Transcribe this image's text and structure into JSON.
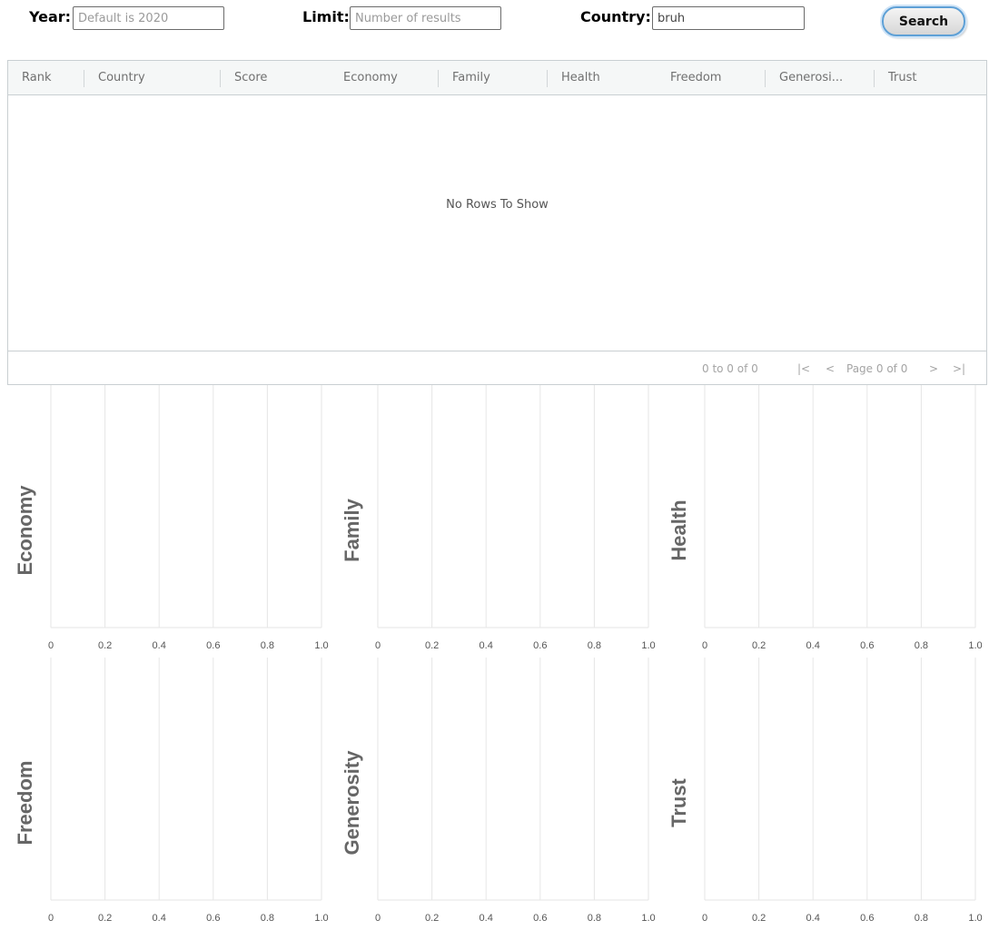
{
  "search": {
    "year_label": "Year:",
    "year_placeholder": "Default is 2020",
    "limit_label": "Limit:",
    "limit_placeholder": "Number of results",
    "country_label": "Country:",
    "country_value": "bruh",
    "search_button": "Search"
  },
  "grid": {
    "columns": [
      "Rank",
      "Country",
      "Score",
      "Economy",
      "Family",
      "Health",
      "Freedom",
      "Generosi...",
      "Trust"
    ],
    "no_rows_text": "No Rows To Show",
    "pagination": {
      "summary": "0 to 0 of 0",
      "first": "|<",
      "prev": "<",
      "page_text": "Page 0 of 0",
      "next": ">",
      "last": ">|"
    }
  },
  "chart_data": [
    {
      "type": "bar",
      "ylabel": "Economy",
      "xlim": [
        0,
        1
      ],
      "x_ticks": [
        "0",
        "0.2",
        "0.4",
        "0.6",
        "0.8",
        "1.0"
      ],
      "categories": [],
      "values": [],
      "grid": true
    },
    {
      "type": "bar",
      "ylabel": "Family",
      "xlim": [
        0,
        1
      ],
      "x_ticks": [
        "0",
        "0.2",
        "0.4",
        "0.6",
        "0.8",
        "1.0"
      ],
      "categories": [],
      "values": [],
      "grid": true
    },
    {
      "type": "bar",
      "ylabel": "Health",
      "xlim": [
        0,
        1
      ],
      "x_ticks": [
        "0",
        "0.2",
        "0.4",
        "0.6",
        "0.8",
        "1.0"
      ],
      "categories": [],
      "values": [],
      "grid": true
    },
    {
      "type": "bar",
      "ylabel": "Freedom",
      "xlim": [
        0,
        1
      ],
      "x_ticks": [
        "0",
        "0.2",
        "0.4",
        "0.6",
        "0.8",
        "1.0"
      ],
      "categories": [],
      "values": [],
      "grid": true
    },
    {
      "type": "bar",
      "ylabel": "Generosity",
      "xlim": [
        0,
        1
      ],
      "x_ticks": [
        "0",
        "0.2",
        "0.4",
        "0.6",
        "0.8",
        "1.0"
      ],
      "categories": [],
      "values": [],
      "grid": true
    },
    {
      "type": "bar",
      "ylabel": "Trust",
      "xlim": [
        0,
        1
      ],
      "x_ticks": [
        "0",
        "0.2",
        "0.4",
        "0.6",
        "0.8",
        "1.0"
      ],
      "categories": [],
      "values": [],
      "grid": true
    }
  ]
}
